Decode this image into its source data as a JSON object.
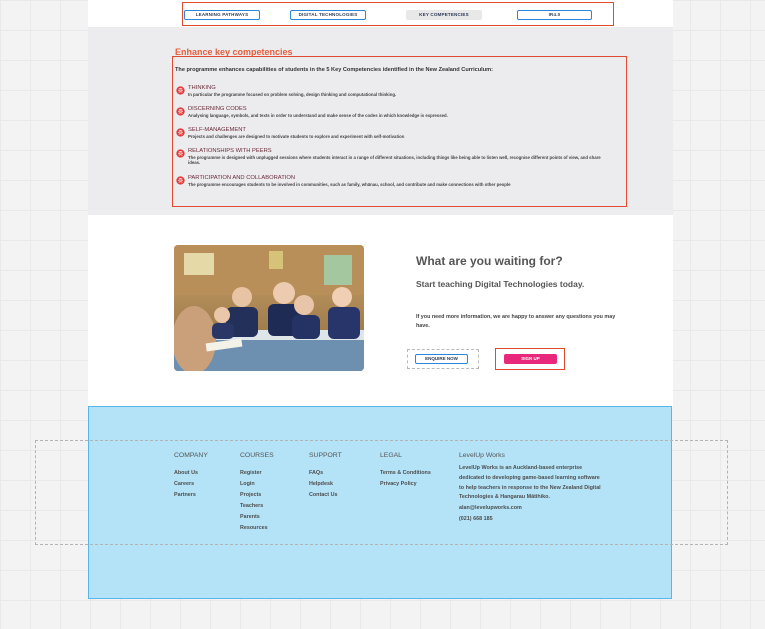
{
  "tabs": [
    {
      "label": "LEARNING PATHWAYS",
      "active": false
    },
    {
      "label": "DIGITAL TECHNOLOGIES",
      "active": false
    },
    {
      "label": "KEY COMPETENCIES",
      "active": true
    },
    {
      "label": "IR4.0",
      "active": false
    }
  ],
  "competencies": {
    "title": "Enhance key competencies",
    "intro": "The programme enhances capabilities of students in the 5 Key Competencies identified in the New Zealand Curriculum:",
    "items": [
      {
        "name": "Thinking",
        "desc": "In particular the programme focused on problem solving, design thinking and computational thinking."
      },
      {
        "name": "Discerning codes",
        "desc": "Analysing language, symbols, and texts in order to understand and make sense of the codes in which knowledge is expressed."
      },
      {
        "name": "Self-Management",
        "desc": "Projects and challenges are designed to motivate students to explore and experiment with self-motivation"
      },
      {
        "name": "Relationships with peers",
        "desc": "The programme is designed with unplugged sessions where students interact in a range of different situations, including things like being able to listen well, recognise different points of view, and share ideas."
      },
      {
        "name": "Participation and collaboration",
        "desc": "The programme encourages students to be involved in communities, such as family, whānau, school, and contribute and make connections with other people"
      }
    ],
    "icon": "brain-icon",
    "icon_color": "#e03a3a"
  },
  "cta": {
    "heading": "What are you waiting for?",
    "subheading": "Start teaching Digital Technologies today.",
    "text": "If you need more information, we are happy to answer any questions you may have.",
    "enquire_label": "ENQUIRE NOW",
    "signup_label": "SIGN UP",
    "photo": "classroom-students-photo"
  },
  "footer": {
    "columns": [
      {
        "heading": "Company",
        "links": [
          "About Us",
          "Careers",
          "Partners"
        ]
      },
      {
        "heading": "Courses",
        "links": [
          "Register",
          "Login",
          "Projects",
          "Teachers",
          "Parents",
          "Resources"
        ]
      },
      {
        "heading": "Support",
        "links": [
          "FAQs",
          "Helpdesk",
          "Contact Us"
        ]
      },
      {
        "heading": "Legal",
        "links": [
          "Terms & Conditions",
          "Privacy Policy"
        ]
      }
    ],
    "about": {
      "heading": "LevelUp Works",
      "desc": "LevelUp Works is an Auckland-based enterprise dedicated to developing game-based learning software to help teachers in response to the New Zealand Digital Technologies & Hangarau Mātihiko.",
      "email": "alan@levelupworks.com",
      "phone": "(021) 668 185"
    },
    "bg_color": "#b4e3f7"
  },
  "colors": {
    "accent_orange": "#e4603f",
    "selection_red": "#e04a2f",
    "button_blue": "#2a86d8",
    "signup_pink": "#e8287a"
  }
}
